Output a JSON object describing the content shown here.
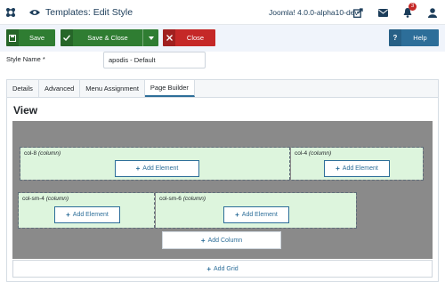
{
  "header": {
    "title": "Templates: Edit Style",
    "version": "Joomla! 4.0.0-alpha10-dev",
    "notification_count": "3",
    "icons": [
      "joomla-logo-icon",
      "eye-icon",
      "external-link-icon",
      "mail-icon",
      "bell-icon",
      "user-icon"
    ]
  },
  "toolbar": {
    "save_label": "Save",
    "save_close_label": "Save & Close",
    "close_label": "Close",
    "help_label": "Help"
  },
  "form": {
    "style_name_label": "Style Name *",
    "style_name_value": "apodis - Default"
  },
  "tabs": [
    {
      "label": "Details",
      "active": false
    },
    {
      "label": "Advanced",
      "active": false
    },
    {
      "label": "Menu Assignment",
      "active": false
    },
    {
      "label": "Page Builder",
      "active": true
    }
  ],
  "builder": {
    "view_title": "View",
    "rows": [
      {
        "columns": [
          {
            "name": "col-8",
            "type": "(column)",
            "add_label": "Add Element"
          },
          {
            "name": "col-4",
            "type": "(column)",
            "add_label": "Add Element"
          }
        ]
      },
      {
        "columns": [
          {
            "name": "col-sm-4",
            "type": "(column)",
            "add_label": "Add Element"
          },
          {
            "name": "col-sm-6",
            "type": "(column)",
            "add_label": "Add Element"
          }
        ]
      }
    ],
    "add_column_label": "Add Column",
    "add_grid_label": "Add Grid"
  },
  "colors": {
    "save_green": "#2f7d32",
    "close_red": "#c52827",
    "help_blue": "#2d6e99",
    "column_green": "#ddf5dd",
    "grid_gray": "#8a8a8a"
  }
}
